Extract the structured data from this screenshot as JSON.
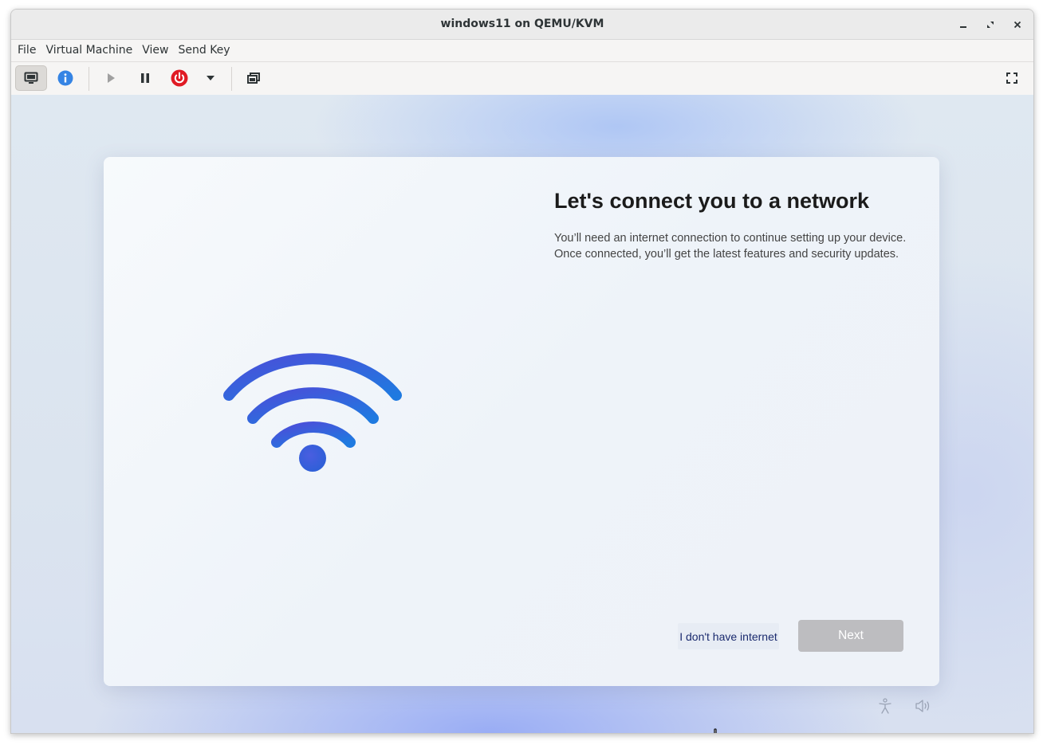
{
  "window": {
    "title": "windows11 on QEMU/KVM",
    "controls": [
      "minimize-icon",
      "restore-icon",
      "close-icon"
    ]
  },
  "menubar": {
    "items": [
      {
        "label": "File"
      },
      {
        "label": "Virtual Machine"
      },
      {
        "label": "View"
      },
      {
        "label": "Send Key"
      }
    ]
  },
  "toolbar": {
    "buttons": [
      "monitor-icon",
      "info-icon",
      "play-icon",
      "pause-icon",
      "power-icon",
      "dropdown-arrow-icon",
      "snapshots-icon",
      "fullscreen-icon"
    ],
    "active": "monitor-icon"
  },
  "oobe": {
    "heading": "Let's connect you to a network",
    "description": "You’ll need an internet connection to continue setting up your device. Once connected, you’ll get the latest features and security updates.",
    "no_internet_label": "I don't have internet",
    "next_label": "Next",
    "bottom_icons": [
      "accessibility-icon",
      "volume-icon"
    ]
  },
  "colors": {
    "power_red": "#e01b24",
    "info_blue": "#3584e4",
    "wifi_start": "#4a4fd9",
    "wifi_end": "#1f7ae0",
    "next_disabled": "#bdbdc0"
  }
}
